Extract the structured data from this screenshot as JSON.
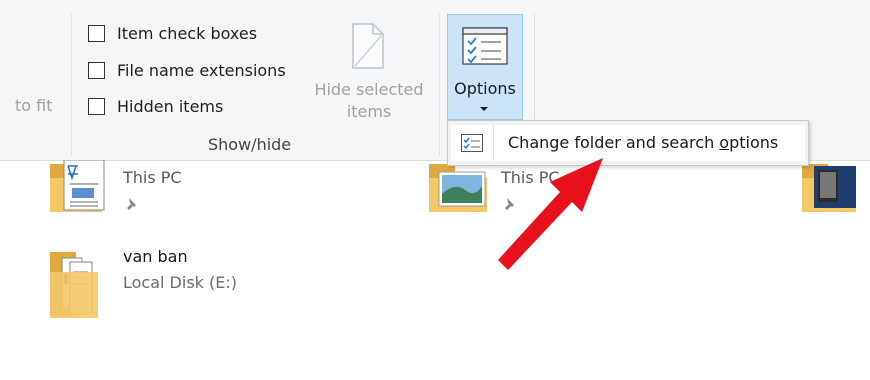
{
  "ribbon": {
    "left_cut_label": "to fit",
    "show_hide": {
      "checkboxes": [
        {
          "label": "Item check boxes",
          "checked": false
        },
        {
          "label": "File name extensions",
          "checked": false
        },
        {
          "label": "Hidden items",
          "checked": false
        }
      ],
      "hide_selected_line1": "Hide selected",
      "hide_selected_line2": "items",
      "group_label": "Show/hide"
    },
    "options_label": "Options"
  },
  "dropdown": {
    "item_prefix": "Change folder and search ",
    "item_underlined": "o",
    "item_suffix": "ptions"
  },
  "content": {
    "items": [
      {
        "title": "This PC",
        "icon": "folder-document-icon",
        "pinned": true
      },
      {
        "title": "This PC",
        "icon": "folder-picture-icon",
        "pinned": true
      },
      {
        "title": "",
        "icon": "folder-photo-icon",
        "pinned": false
      },
      {
        "title": "van ban",
        "subtitle": "Local Disk (E:)",
        "icon": "folder-files-icon"
      }
    ]
  },
  "colors": {
    "options_hover": "#cce4f7",
    "options_border": "#99c9ef",
    "arrow": "#e8101b",
    "folder": "#f3c867"
  }
}
